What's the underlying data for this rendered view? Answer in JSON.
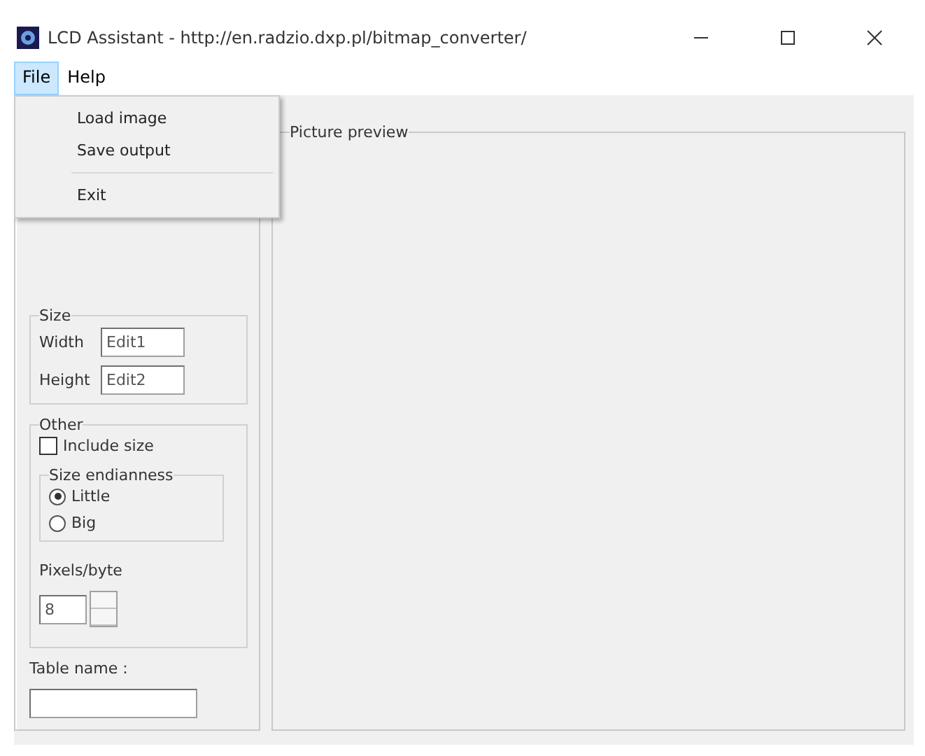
{
  "window": {
    "title": "LCD Assistant - http://en.radzio.dxp.pl/bitmap_converter/"
  },
  "menu_bar": [
    {
      "label": "File",
      "selected": true
    },
    {
      "label": "Help",
      "selected": false
    }
  ],
  "file_menu": [
    {
      "kind": "item",
      "label": "Load image"
    },
    {
      "kind": "item",
      "label": "Save output"
    },
    {
      "kind": "separator"
    },
    {
      "kind": "item",
      "label": "Exit"
    }
  ],
  "size_group": {
    "title": "Size",
    "width_label": "Width",
    "width_value": "Edit1",
    "height_label": "Height",
    "height_value": "Edit2"
  },
  "other_group": {
    "title": "Other",
    "include_size": {
      "label": "Include size",
      "checked": false
    },
    "endianness": {
      "title": "Size endianness",
      "options": [
        {
          "label": "Little",
          "selected": true
        },
        {
          "label": "Big",
          "selected": false
        }
      ]
    },
    "pixels_label": "Pixels/byte",
    "pixels_value": "8"
  },
  "table_name": {
    "label": "Table name :"
  },
  "preview": {
    "title": "Picture preview"
  }
}
